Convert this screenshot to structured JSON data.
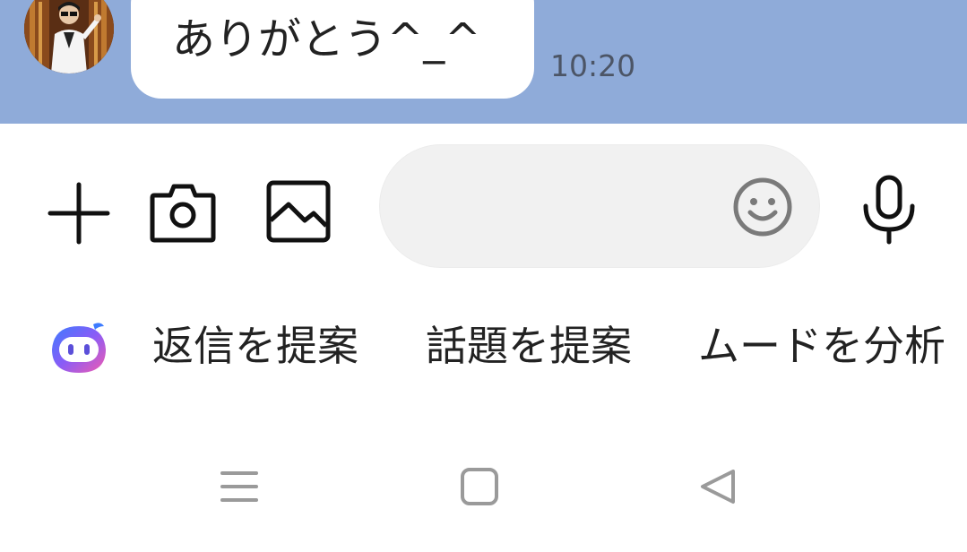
{
  "chat": {
    "message_text": "ありがとう^_^",
    "timestamp": "10:20",
    "background_color": "#8fabd9"
  },
  "input_bar": {
    "plus_icon": "plus-icon",
    "camera_icon": "camera-icon",
    "image_icon": "image-icon",
    "message_placeholder": "",
    "message_value": "",
    "emoji_icon": "smiley-icon",
    "mic_icon": "microphone-icon"
  },
  "suggestions": {
    "assistant_icon": "assistant-bot-icon",
    "items": [
      {
        "label": "返信を提案"
      },
      {
        "label": "話題を提案"
      },
      {
        "label": "ムードを分析"
      }
    ]
  },
  "nav": {
    "menu_icon": "menu-lines-icon",
    "home_icon": "home-square-icon",
    "back_icon": "back-triangle-icon"
  }
}
